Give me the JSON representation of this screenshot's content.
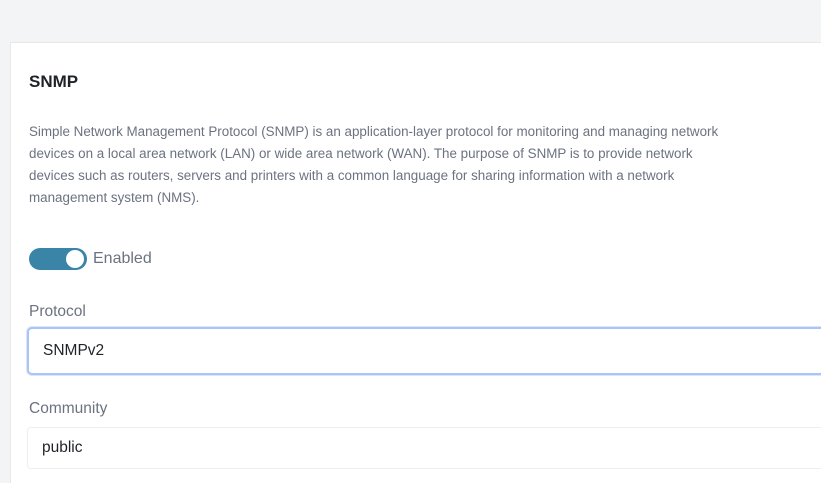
{
  "section": {
    "title": "SNMP",
    "description_lines": [
      "Simple Network Management Protocol (SNMP) is an application-layer protocol for monitoring and managing network",
      "devices on a local area network (LAN) or wide area network (WAN). The purpose of SNMP is to provide network",
      "devices such as routers, servers and printers with a common language for sharing information with a network",
      "management system (NMS)."
    ]
  },
  "enabled_toggle": {
    "label": "Enabled",
    "on": true
  },
  "protocol": {
    "label": "Protocol",
    "value": "SNMPv2"
  },
  "community": {
    "label": "Community",
    "value": "public"
  },
  "colors": {
    "toggle_on": "#3a84a8",
    "focus_border": "#a9c4f5"
  }
}
